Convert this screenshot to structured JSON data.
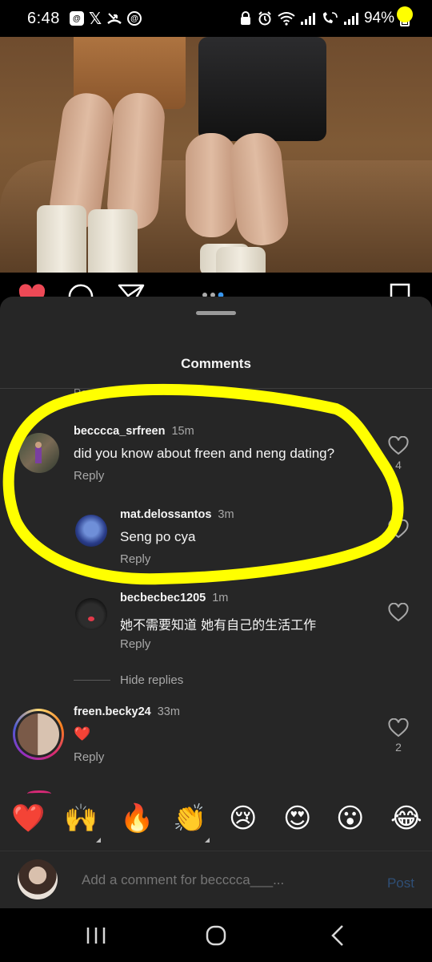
{
  "status_bar": {
    "time": "6:48",
    "battery": "94%",
    "notification_icons": [
      "threads-icon",
      "x-icon",
      "missed-call-icon",
      "at-sign-icon"
    ],
    "system_icons": [
      "lock-icon",
      "alarm-icon",
      "wifi-icon",
      "signal-icon",
      "wifi-call-icon",
      "signal-icon-2",
      "battery-icon"
    ],
    "accent_dot_color": "#ffff00"
  },
  "post_actions": {
    "icons": [
      "heart-filled-icon",
      "comment-icon",
      "share-icon",
      "carousel-dots-icon",
      "bookmark-icon"
    ],
    "like_color": "#ed4956"
  },
  "comments_sheet": {
    "title": "Comments",
    "peek_text": "Rep",
    "comments": [
      {
        "username": "becccca_srfreen",
        "time": "15m",
        "text": "did you know about freen and neng dating?",
        "reply_label": "Reply",
        "likes": "4"
      },
      {
        "username": "mat.delossantos",
        "time": "3m",
        "text": "Seng po cya",
        "reply_label": "Reply",
        "likes": ""
      },
      {
        "username": "becbecbec1205",
        "time": "1m",
        "text": "她不需要知道 她有自己的生活工作",
        "reply_label": "Reply",
        "likes": ""
      },
      {
        "username": "freen.becky24",
        "time": "33m",
        "text": "❤️",
        "reply_label": "Reply",
        "likes": "2"
      }
    ],
    "hide_replies": "Hide replies",
    "highlight_color": "#ffff00"
  },
  "emoji_bar": [
    "❤️",
    "🙌",
    "🔥",
    "👏",
    "😢",
    "😍",
    "😮",
    "😂"
  ],
  "comment_input": {
    "placeholder": "Add a comment for becccca___...",
    "post_label": "Post"
  },
  "nav_bar": {
    "icons": [
      "recent-apps-icon",
      "home-icon",
      "back-icon"
    ]
  }
}
